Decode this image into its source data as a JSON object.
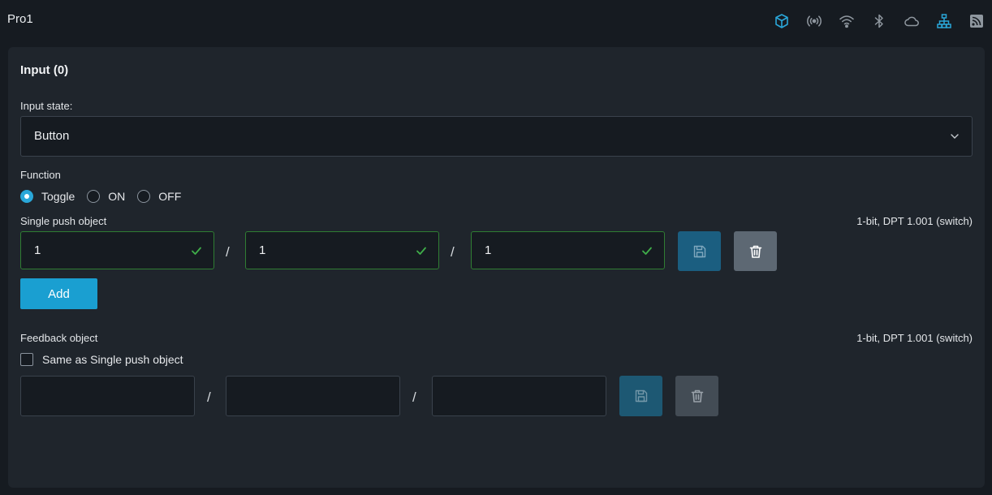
{
  "app": {
    "title": "Pro1"
  },
  "status_icons": [
    {
      "name": "cube-icon",
      "color": "#2aa7d9"
    },
    {
      "name": "broadcast-icon",
      "color": "#8f979f"
    },
    {
      "name": "wifi-icon",
      "color": "#8f979f"
    },
    {
      "name": "bluetooth-icon",
      "color": "#8f979f"
    },
    {
      "name": "cloud-icon",
      "color": "#8f979f"
    },
    {
      "name": "network-icon",
      "color": "#2aa7d9"
    },
    {
      "name": "rss-icon",
      "color": "#8f979f"
    }
  ],
  "card": {
    "title": "Input (0)",
    "input_state": {
      "label": "Input state:",
      "value": "Button"
    },
    "function": {
      "label": "Function",
      "options": [
        {
          "label": "Toggle",
          "checked": true
        },
        {
          "label": "ON",
          "checked": false
        },
        {
          "label": "OFF",
          "checked": false
        }
      ]
    },
    "single_push": {
      "label": "Single push object",
      "type_info": "1-bit, DPT 1.001 (switch)",
      "address": [
        "1",
        "1",
        "1"
      ],
      "separator": "/"
    },
    "add_label": "Add",
    "feedback": {
      "label": "Feedback object",
      "type_info": "1-bit, DPT 1.001 (switch)",
      "same_as_label": "Same as Single push object",
      "same_as_checked": false,
      "address": [
        "",
        "",
        ""
      ],
      "separator": "/"
    }
  },
  "colors": {
    "accent": "#1a9fd1",
    "valid_border": "#2f7d33",
    "check": "#3fae49"
  }
}
